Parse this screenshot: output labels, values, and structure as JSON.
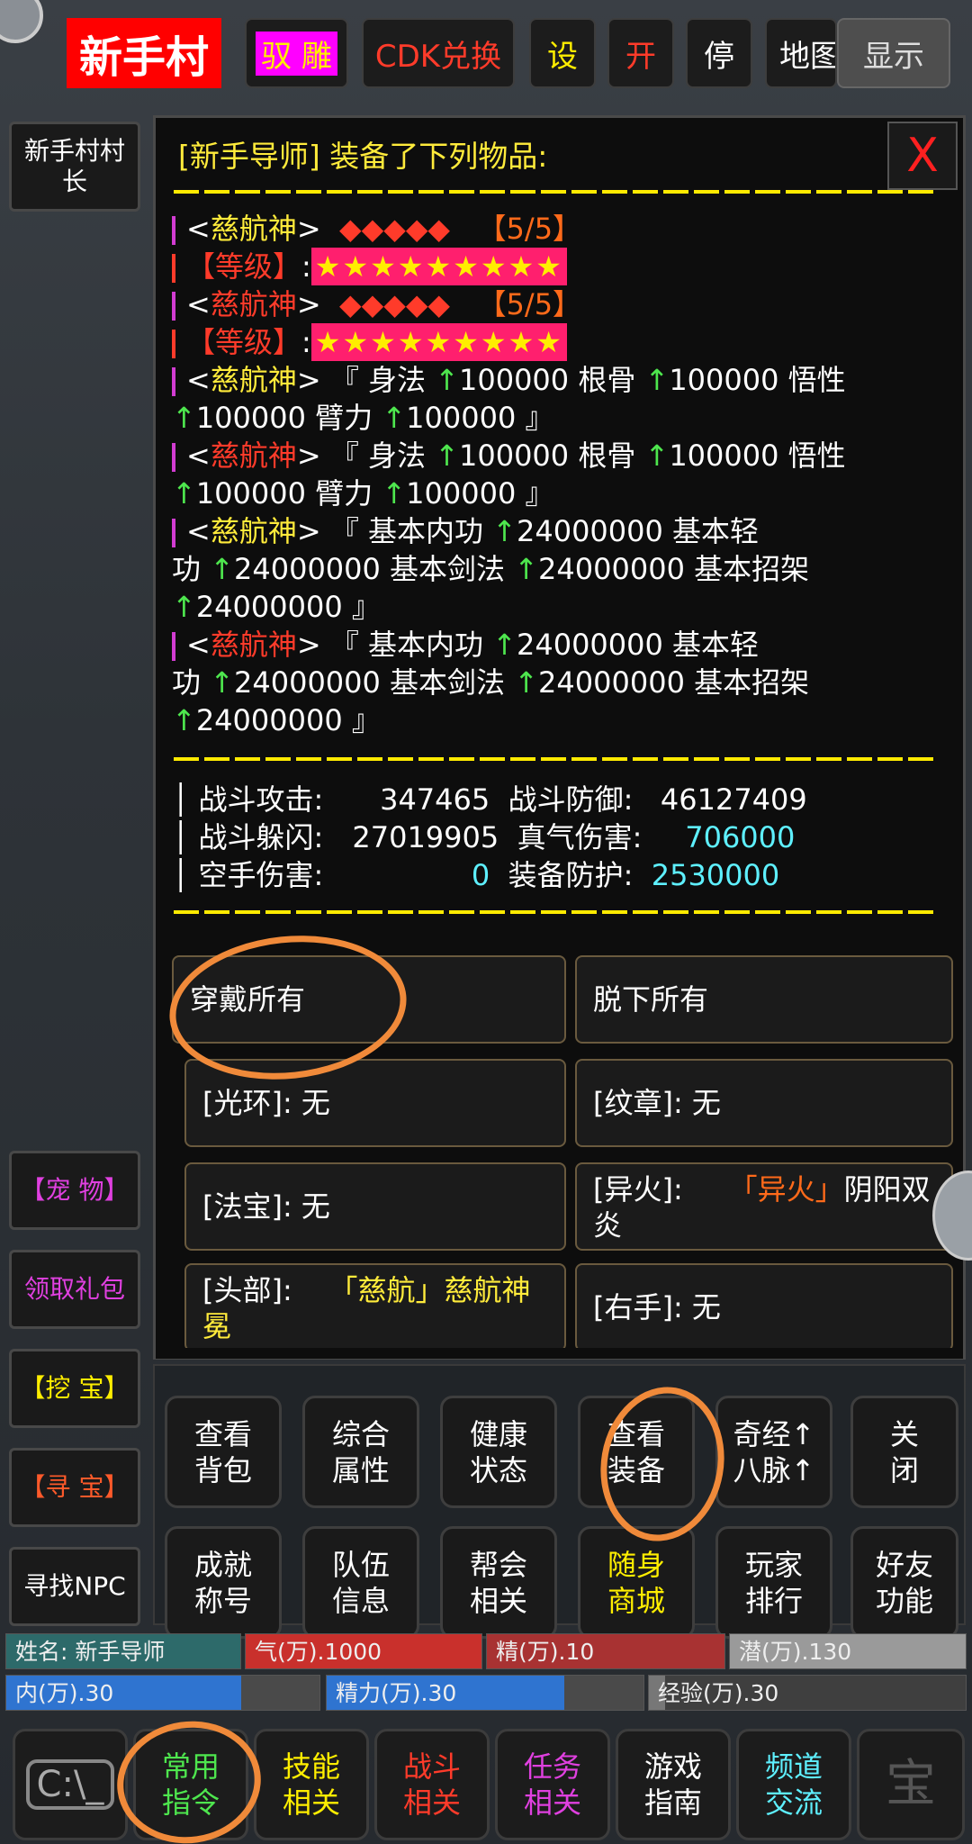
{
  "colors": {
    "accent": "#ffeb3b",
    "red": "#ff3b2a",
    "green": "#4ee64e",
    "cyan": "#5ef0ff",
    "magenta": "#d23cd2",
    "annotation": "#f08a3a"
  },
  "topbar": {
    "title": "新手村",
    "buttons": [
      "驭 雕",
      "CDK兑换",
      "设",
      "开",
      "停",
      "地图",
      "显示"
    ]
  },
  "sidebar": {
    "npc": "新手村村长",
    "items": [
      "【宠 物】",
      "领取礼包",
      "【挖 宝】",
      "【寻 宝】",
      "寻找NPC"
    ]
  },
  "panel": {
    "header": "[新手导师] 装备了下列物品:",
    "close": "X",
    "lines": {
      "l1a": "<",
      "l1n": "慈航神",
      "l1b": ">",
      "l1d": "◆◆◆◆◆",
      "l1c": "【5/5】",
      "l2lv": "【等级】",
      "l2s": "★★★★★★★★★",
      "l3a": "<",
      "l3n": "慈航神",
      "l3b": ">",
      "l3d": "◆◆◆◆◆",
      "l3c": "【5/5】",
      "l4lv": "【等级】",
      "l4s": "★★★★★★★★★",
      "l5a": "<",
      "l5n": "慈航神",
      "l5b": "> 『 身法 ",
      "l5u1": "↑",
      "l5v1": "100000 根骨 ",
      "l5u2": "↑",
      "l5v2": "100000 悟性",
      "l6u1": "↑",
      "l6v1": "100000 臂力 ",
      "l6u2": "↑",
      "l6v2": "100000 』",
      "l7a": "<",
      "l7n": "慈航神",
      "l7b": "> 『 身法 ",
      "l7u1": "↑",
      "l7v1": "100000 根骨 ",
      "l7u2": "↑",
      "l7v2": "100000 悟性",
      "l8u1": "↑",
      "l8v1": "100000 臂力 ",
      "l8u2": "↑",
      "l8v2": "100000 』",
      "l9a": "<",
      "l9n": "慈航神",
      "l9b": "> 『 基本内功 ",
      "l9u": "↑",
      "l9v": "24000000 基本轻",
      "l10a": "功 ",
      "l10u1": "↑",
      "l10v1": "24000000 基本剑法 ",
      "l10u2": "↑",
      "l10v2": "24000000 基本招架",
      "l11u": "↑",
      "l11v": "24000000 』",
      "l12a": "<",
      "l12n": "慈航神",
      "l12b": "> 『 基本内功 ",
      "l12u": "↑",
      "l12v": "24000000 基本轻",
      "l13a": "功 ",
      "l13u1": "↑",
      "l13v1": "24000000 基本剑法 ",
      "l13u2": "↑",
      "l13v2": "24000000 基本招架",
      "l14u": "↑",
      "l14v": "24000000 』"
    },
    "stats": {
      "atk_label": "战斗攻击:",
      "atk": "347465",
      "def_label": "战斗防御:",
      "def": "46127409",
      "eva_label": "战斗躲闪:",
      "eva": "27019905",
      "qi_label": "真气伤害:",
      "qi": "706000",
      "fist_label": "空手伤害:",
      "fist": "0",
      "armor_label": "装备防护:",
      "armor": "2530000"
    },
    "slots": {
      "wear_all": "穿戴所有",
      "remove_all": "脱下所有",
      "halo": "[光环]: 无",
      "emblem": "[纹章]: 无",
      "treasure": "[法宝]: 无",
      "fire_label": "[异火]: ",
      "fire_q": "「异火」",
      "fire_name": "阴阳双炎",
      "head_label": "[头部]: ",
      "head_item": "「慈航」慈航神冕",
      "right_hand": "[右手]: 无"
    }
  },
  "commands": {
    "row1": [
      "查看\n背包",
      "综合\n属性",
      "健康\n状态",
      "查看\n装备",
      "奇经↑\n八脉↑",
      "关\n闭"
    ],
    "row2": [
      "成就\n称号",
      "队伍\n信息",
      "帮会\n相关",
      "随身\n商城",
      "玩家\n排行",
      "好友\n功能"
    ]
  },
  "status": {
    "name": "姓名: 新手导师",
    "qi": "气(万).1000",
    "jing": "精(万).10",
    "qian": "潜(万).130",
    "nei": "内(万).30",
    "jingli": "精力(万).30",
    "exp": "经验(万).30",
    "nei_pct": 0.75,
    "jingli_pct": 0.75,
    "exp_pct": 0.05
  },
  "bottom": {
    "console": "C:\\_",
    "tabs": [
      "常用\n指令",
      "技能\n相关",
      "战斗\n相关",
      "任务\n相关",
      "游戏\n指南",
      "频道\n交流"
    ],
    "last": "宝"
  }
}
